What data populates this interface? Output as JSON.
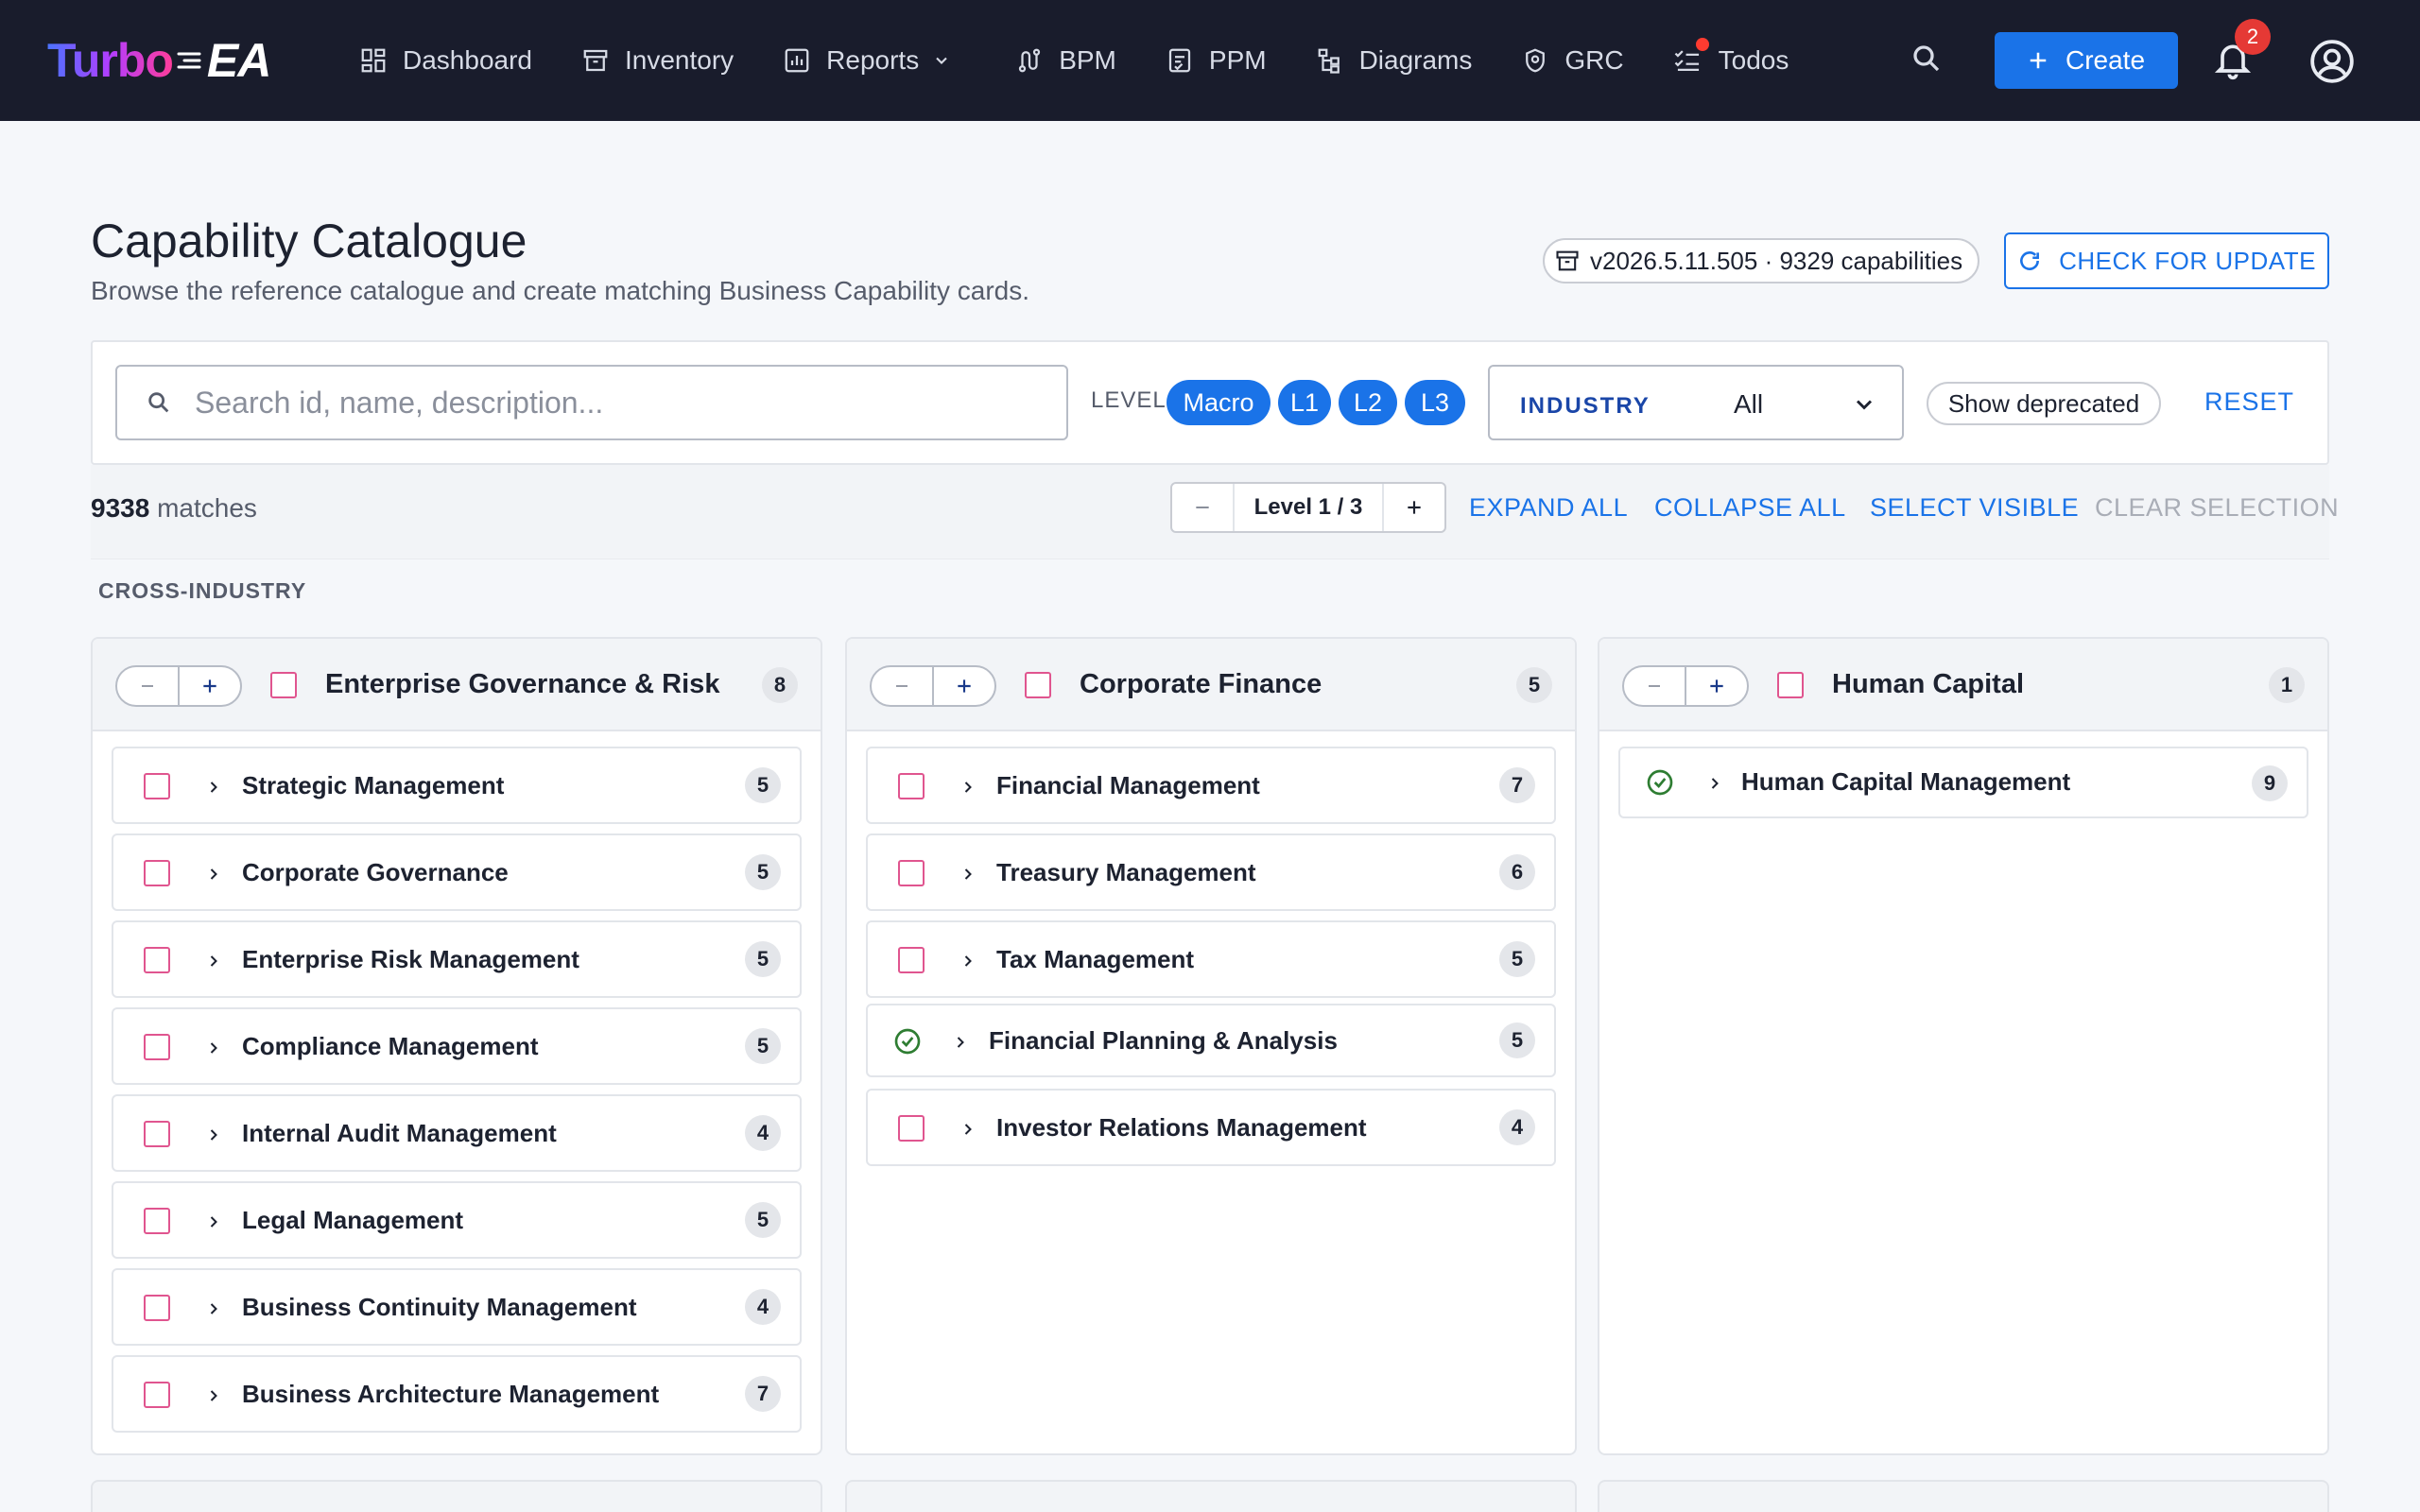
{
  "app": {
    "logo_primary": "Turbo",
    "logo_secondary": "EA",
    "brand_gradient": [
      "#4b73ff",
      "#b23dff",
      "#ff3d9a"
    ]
  },
  "nav": {
    "items": [
      {
        "label": "Dashboard",
        "icon": "dashboard-icon"
      },
      {
        "label": "Inventory",
        "icon": "archive-icon"
      },
      {
        "label": "Reports",
        "icon": "chart-icon",
        "has_dropdown": true
      },
      {
        "label": "BPM",
        "icon": "flow-icon"
      },
      {
        "label": "PPM",
        "icon": "project-icon"
      },
      {
        "label": "Diagrams",
        "icon": "diagram-icon"
      },
      {
        "label": "GRC",
        "icon": "shield-icon"
      },
      {
        "label": "Todos",
        "icon": "checklist-icon",
        "has_notification_dot": true
      }
    ],
    "create_label": "Create",
    "notification_count": "2"
  },
  "header": {
    "title": "Capability Catalogue",
    "subtitle": "Browse the reference catalogue and create matching Business Capability cards.",
    "version": "v2026.5.11.505 · 9329 capabilities",
    "check_update_label": "CHECK FOR UPDATE"
  },
  "filters": {
    "search_placeholder": "Search id, name, description...",
    "search_value": "",
    "level_label": "LEVEL",
    "levels": [
      "Macro",
      "L1",
      "L2",
      "L3"
    ],
    "industry_label": "INDUSTRY",
    "industry_value": "All",
    "show_deprecated_label": "Show deprecated",
    "reset_label": "RESET"
  },
  "toolbar": {
    "matches_count": "9338",
    "matches_label": "matches",
    "level_display": "Level 1 / 3",
    "expand_all": "EXPAND ALL",
    "collapse_all": "COLLAPSE ALL",
    "select_visible": "SELECT VISIBLE",
    "clear_selection": "CLEAR SELECTION"
  },
  "section_label": "CROSS-INDUSTRY",
  "cards": [
    {
      "title": "Enterprise Governance & Risk",
      "count": "8",
      "items": [
        {
          "label": "Strategic Management",
          "count": "5",
          "existing": false
        },
        {
          "label": "Corporate Governance",
          "count": "5",
          "existing": false
        },
        {
          "label": "Enterprise Risk Management",
          "count": "5",
          "existing": false
        },
        {
          "label": "Compliance Management",
          "count": "5",
          "existing": false
        },
        {
          "label": "Internal Audit Management",
          "count": "4",
          "existing": false
        },
        {
          "label": "Legal Management",
          "count": "5",
          "existing": false
        },
        {
          "label": "Business Continuity Management",
          "count": "4",
          "existing": false
        },
        {
          "label": "Business Architecture Management",
          "count": "7",
          "existing": false
        }
      ]
    },
    {
      "title": "Corporate Finance",
      "count": "5",
      "items": [
        {
          "label": "Financial Management",
          "count": "7",
          "existing": false
        },
        {
          "label": "Treasury Management",
          "count": "6",
          "existing": false
        },
        {
          "label": "Tax Management",
          "count": "5",
          "existing": false
        },
        {
          "label": "Financial Planning & Analysis",
          "count": "5",
          "existing": true
        },
        {
          "label": "Investor Relations Management",
          "count": "4",
          "existing": false
        }
      ]
    },
    {
      "title": "Human Capital",
      "count": "1",
      "items": [
        {
          "label": "Human Capital Management",
          "count": "9",
          "existing": true
        }
      ]
    }
  ],
  "colors": {
    "topbar": "#191c2c",
    "accent": "#1a73e8",
    "checkbox": "#e0558f",
    "existing_check": "#2e7d32"
  }
}
